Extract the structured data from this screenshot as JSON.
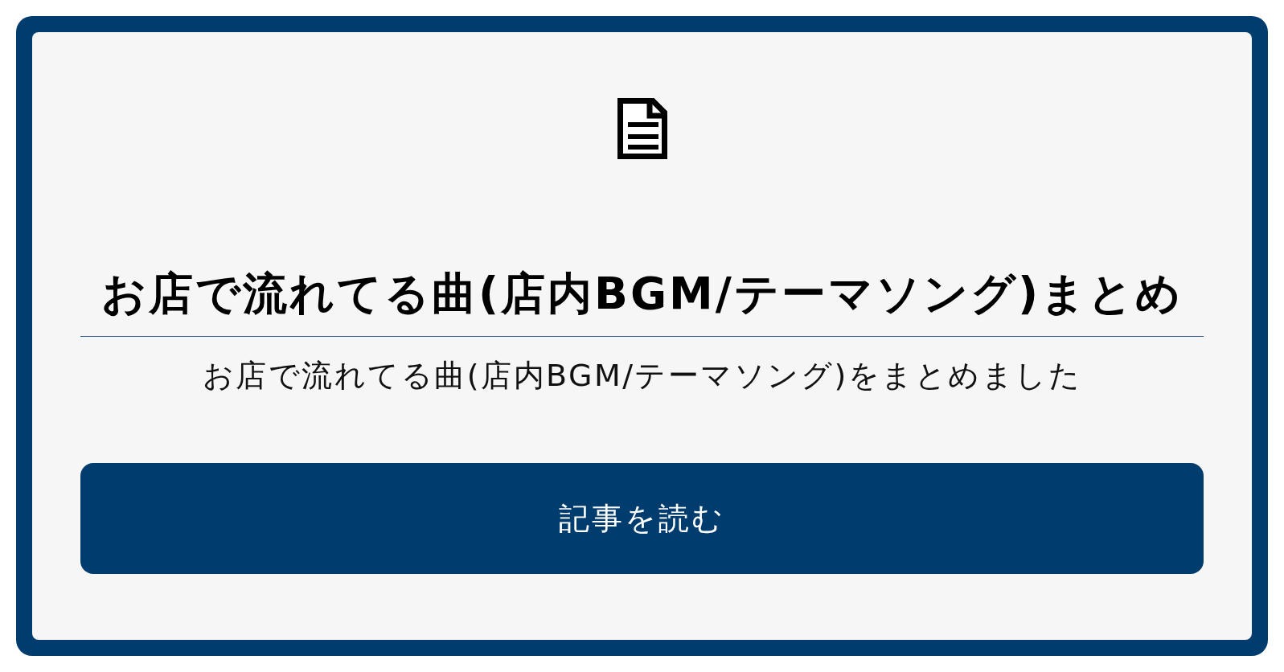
{
  "card": {
    "title": "お店で流れてる曲(店内BGM/テーマソング)まとめ",
    "description": "お店で流れてる曲(店内BGM/テーマソング)をまとめました",
    "button": {
      "label": "記事を読む"
    }
  }
}
